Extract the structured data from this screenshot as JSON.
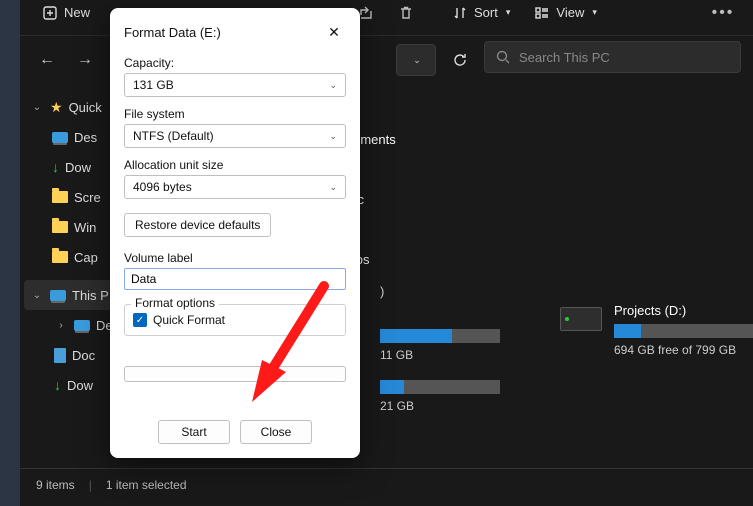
{
  "toolbar": {
    "new_label": "New",
    "sort_label": "Sort",
    "view_label": "View"
  },
  "search": {
    "placeholder": "Search This PC"
  },
  "sidebar": {
    "quick": "Quick",
    "items": [
      "Des",
      "Dow",
      "Scre",
      "Win",
      "Cap"
    ],
    "thispc": "This P",
    "pc_items": [
      "Des",
      "Doc",
      "Dow"
    ]
  },
  "libraries": {
    "documents": "Documents",
    "music": "Music",
    "videos": "Videos"
  },
  "section_count_suffix": ")",
  "drives": {
    "local": {
      "size_line": "11 GB",
      "extra_line": "21 GB"
    },
    "projects": {
      "title": "Projects (D:)",
      "sub": "694 GB free of 799 GB",
      "fill_pct": 13
    }
  },
  "status": {
    "items": "9 items",
    "selected": "1 item selected"
  },
  "dialog": {
    "title": "Format Data (E:)",
    "capacity_label": "Capacity:",
    "capacity_value": "131 GB",
    "fs_label": "File system",
    "fs_value": "NTFS (Default)",
    "alloc_label": "Allocation unit size",
    "alloc_value": "4096 bytes",
    "restore_label": "Restore device defaults",
    "volume_label_caption": "Volume label",
    "volume_label_value": "Data",
    "format_options": "Format options",
    "quick_format": "Quick Format",
    "start": "Start",
    "close": "Close"
  }
}
